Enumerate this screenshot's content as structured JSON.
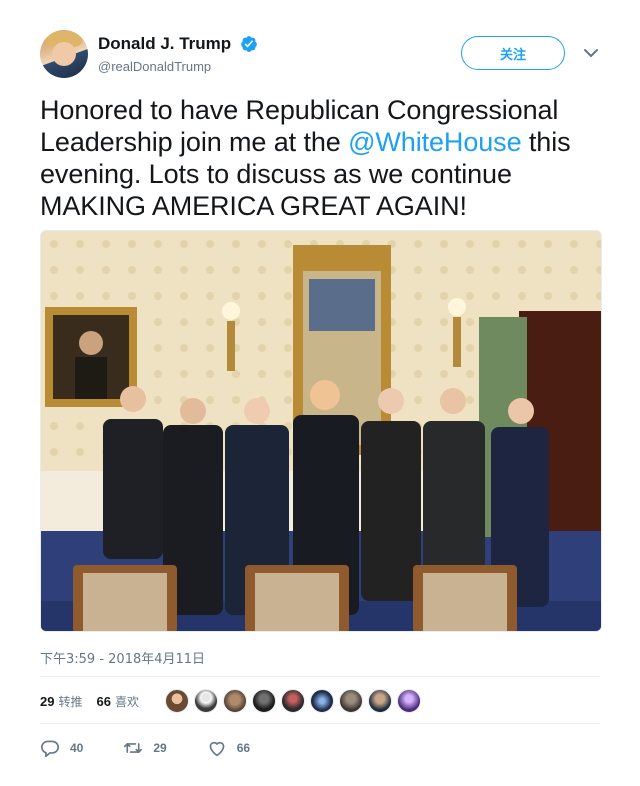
{
  "author": {
    "display_name": "Donald J. Trump",
    "handle": "@realDonaldTrump",
    "verified": true
  },
  "follow_button": {
    "label": "关注"
  },
  "tweet": {
    "text_before": "Honored to have Republican Congressional Leadership join me at the ",
    "mention": "@WhiteHouse",
    "text_after": " this evening. Lots to discuss as we continue MAKING AMERICA GREAT AGAIN!"
  },
  "timestamp": "下午3:59 - 2018年4月11日",
  "stats": {
    "retweets": {
      "count": "29",
      "label": "转推"
    },
    "likes": {
      "count": "66",
      "label": "喜欢"
    }
  },
  "actions": {
    "reply_count": "40",
    "retweet_count": "29",
    "like_count": "66"
  },
  "colors": {
    "accent": "#1da1f2",
    "muted": "#657786",
    "text": "#14171a",
    "divider": "#e6ecf0"
  },
  "icons": [
    "verified-badge-icon",
    "chevron-down-icon",
    "reply-icon",
    "retweet-icon",
    "heart-icon"
  ]
}
